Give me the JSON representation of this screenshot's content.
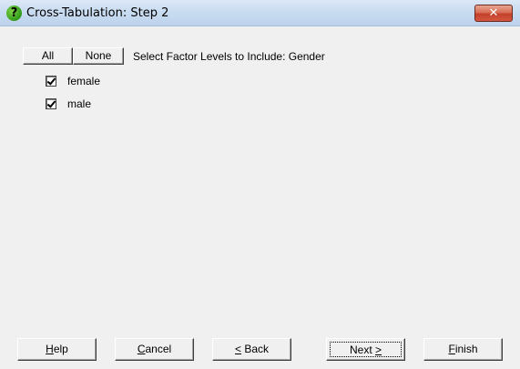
{
  "window": {
    "title": "Cross-Tabulation: Step 2",
    "icon": "help-question-icon",
    "close_glyph": "✕"
  },
  "toolbar": {
    "all_label": "All",
    "none_label": "None",
    "instruction": "Select Factor Levels to Include: Gender"
  },
  "levels": [
    {
      "label": "female",
      "checked": true
    },
    {
      "label": "male",
      "checked": true
    }
  ],
  "buttons": {
    "help": {
      "mnemonic": "H",
      "rest": "elp"
    },
    "cancel": {
      "mnemonic": "C",
      "rest": "ancel"
    },
    "back": {
      "mnemonic": "<",
      "rest": " Back"
    },
    "next": {
      "pre": "Next ",
      "mnemonic": ">"
    },
    "finish": {
      "mnemonic": "F",
      "rest": "inish"
    }
  },
  "colors": {
    "title_bar": "#c9dcf1",
    "close_button": "#c4402a",
    "dialog_bg": "#f0f0f0"
  }
}
